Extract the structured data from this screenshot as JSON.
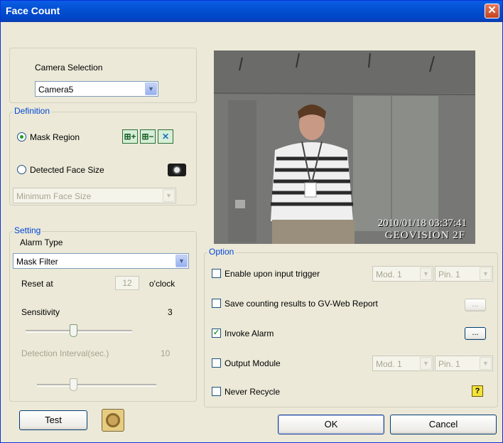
{
  "window": {
    "title": "Face Count",
    "close_glyph": "✕"
  },
  "camera": {
    "label": "Camera Selection",
    "selected": "Camera5"
  },
  "definition": {
    "legend": "Definition",
    "mask_region": "Mask Region",
    "detected_face_size": "Detected Face Size",
    "min_face_size": "Minimum Face Size",
    "icons": [
      "mask-add-icon",
      "mask-remove-icon",
      "mask-clear-icon",
      "camera-snapshot-icon"
    ]
  },
  "setting": {
    "legend": "Setting",
    "alarm_type_label": "Alarm Type",
    "alarm_type_value": "Mask Filter",
    "reset_at_label": "Reset at",
    "reset_at_value": "12",
    "reset_at_unit": "o'clock",
    "sensitivity_label": "Sensitivity",
    "sensitivity_value": "3",
    "detection_interval_label": "Detection Interval(sec.)",
    "detection_interval_value": "10"
  },
  "video": {
    "timestamp": "2010/01/18 03:37:41",
    "location": "GEOVISION 2F"
  },
  "option": {
    "legend": "Option",
    "enable_input_trigger": {
      "label": "Enable upon input trigger",
      "checked": false,
      "module": "Mod. 1",
      "pin": "Pin. 1"
    },
    "save_results": {
      "label": "Save counting results to GV-Web Report",
      "checked": false
    },
    "invoke_alarm": {
      "label": "Invoke Alarm",
      "checked": true
    },
    "output_module": {
      "label": "Output Module",
      "checked": false,
      "module": "Mod. 1",
      "pin": "Pin. 1"
    },
    "never_recycle": {
      "label": "Never Recycle",
      "checked": false
    },
    "ellipsis": "..."
  },
  "buttons": {
    "test": "Test",
    "ok": "OK",
    "cancel": "Cancel"
  },
  "colors": {
    "title_bar": "#0450d2",
    "legend_text": "#0046d5",
    "face": "#ece9d8"
  }
}
